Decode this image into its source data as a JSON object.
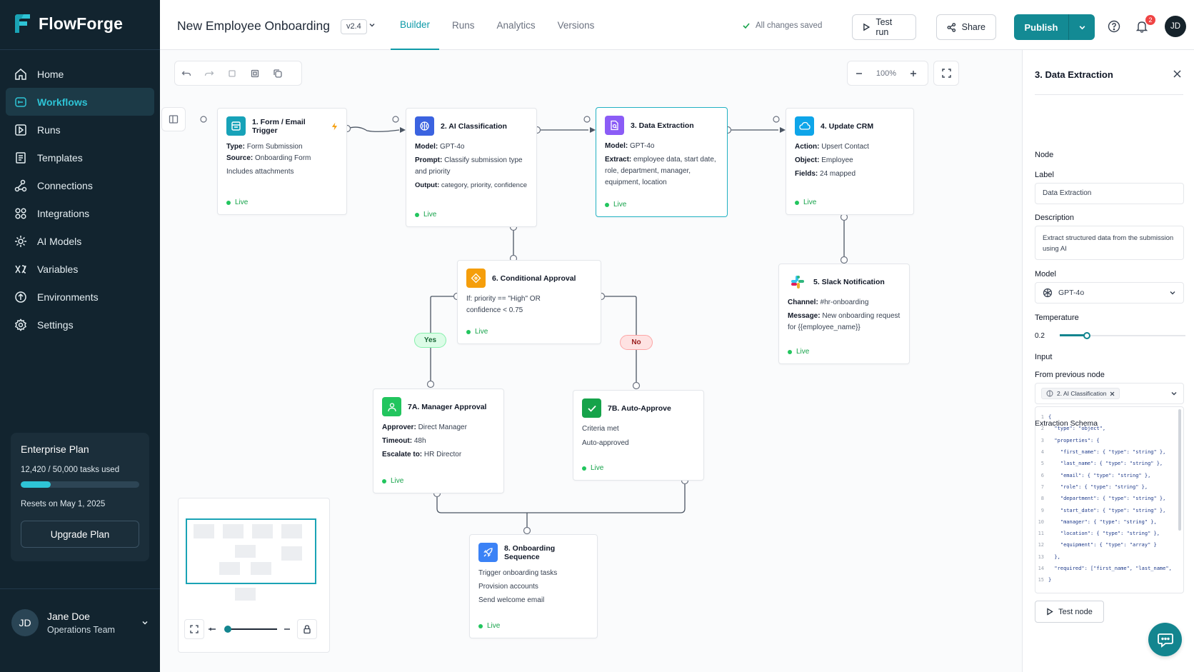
{
  "app": {
    "name": "FlowForge"
  },
  "sidebar": {
    "items": [
      {
        "label": "Home",
        "icon": "home-icon"
      },
      {
        "label": "Workflows",
        "icon": "workflow-icon",
        "active": true
      },
      {
        "label": "Runs",
        "icon": "runs-icon"
      },
      {
        "label": "Templates",
        "icon": "templates-icon"
      },
      {
        "label": "Connections",
        "icon": "connections-icon"
      },
      {
        "label": "Integrations",
        "icon": "integrations-icon"
      },
      {
        "label": "AI Models",
        "icon": "ai-models-icon"
      },
      {
        "label": "Variables",
        "icon": "variables-icon"
      },
      {
        "label": "Environments",
        "icon": "environments-icon"
      },
      {
        "label": "Settings",
        "icon": "settings-icon"
      }
    ],
    "plan": {
      "title": "Enterprise Plan",
      "usage": "12,420 / 50,000 tasks used",
      "usage_fraction": 0.25,
      "reset": "Resets on May 1, 2025",
      "button": "Upgrade Plan"
    },
    "user": {
      "initials": "JD",
      "name": "Jane Doe",
      "team": "Operations Team"
    }
  },
  "header": {
    "title": "New Employee Onboarding",
    "version": "v2.4",
    "tabs": [
      "Builder",
      "Runs",
      "Analytics",
      "Versions"
    ],
    "active_tab": "Builder",
    "saved": "All changes saved",
    "test_run": "Test run",
    "share": "Share",
    "publish": "Publish",
    "notifications": "2",
    "avatar": "JD"
  },
  "canvas": {
    "zoom": "100%"
  },
  "nodes": {
    "n1": {
      "title": "1. Form / Email Trigger",
      "rows": [
        {
          "k": "Type:",
          "v": " Form Submission"
        },
        {
          "k": "Source:",
          "v": " Onboarding Form"
        },
        {
          "k": "",
          "v": "Includes attachments"
        }
      ],
      "status": "Live"
    },
    "n2": {
      "title": "2. AI Classification",
      "rows": [
        {
          "k": "Model:",
          "v": " GPT-4o"
        },
        {
          "k": "Prompt:",
          "v": " Classify submission type and priority"
        },
        {
          "k": "Output:",
          "v": " category, priority, confidence"
        }
      ],
      "status": "Live"
    },
    "n3": {
      "title": "3. Data Extraction",
      "rows": [
        {
          "k": "Model:",
          "v": " GPT-4o"
        },
        {
          "k": "Extract:",
          "v": " employee data, start date, role, department, manager, equipment, location"
        }
      ],
      "status": "Live"
    },
    "n4": {
      "title": "4. Update CRM",
      "rows": [
        {
          "k": "Action:",
          "v": " Upsert Contact"
        },
        {
          "k": "Object:",
          "v": " Employee"
        },
        {
          "k": "Fields:",
          "v": " 24 mapped"
        }
      ],
      "status": "Live"
    },
    "n5": {
      "title": "5. Slack Notification",
      "rows": [
        {
          "k": "Channel:",
          "v": " #hr-onboarding"
        },
        {
          "k": "Message:",
          "v": " New onboarding request for {{employee_name}}"
        }
      ],
      "status": "Live"
    },
    "n6": {
      "title": "6. Conditional Approval",
      "rows": [
        {
          "k": "",
          "v": "If: priority == \"High\" OR confidence < 0.75"
        }
      ],
      "status": "Live"
    },
    "n7a": {
      "title": "7A. Manager Approval",
      "rows": [
        {
          "k": "Approver:",
          "v": " Direct Manager"
        },
        {
          "k": "Timeout:",
          "v": " 48h"
        },
        {
          "k": "Escalate to:",
          "v": " HR Director"
        }
      ],
      "status": "Live"
    },
    "n7b": {
      "title": "7B. Auto-Approve",
      "rows": [
        {
          "k": "",
          "v": "Criteria met"
        },
        {
          "k": "",
          "v": "Auto-approved"
        }
      ],
      "status": "Live"
    },
    "n8": {
      "title": "8. Onboarding Sequence",
      "rows": [
        {
          "k": "",
          "v": "Trigger onboarding tasks"
        },
        {
          "k": "",
          "v": "Provision accounts"
        },
        {
          "k": "",
          "v": "Send welcome email"
        }
      ],
      "status": "Live"
    }
  },
  "branches": {
    "yes": "Yes",
    "no": "No"
  },
  "panel": {
    "title": "3. Data Extraction",
    "section": "Node",
    "label_label": "Label",
    "label_value": "Data Extraction",
    "desc_label": "Description",
    "desc_value": "Extract structured data from the submission using AI",
    "model_label": "Model",
    "model_value": "GPT-4o",
    "temp_label": "Temperature",
    "temp_value": "0.2",
    "input_label": "Input",
    "input_sub": "From previous node",
    "input_chip": "2. AI Classification",
    "schema_label": "Extraction Schema",
    "schema_lines": [
      "{",
      "  \"type\": \"object\",",
      "  \"properties\": {",
      "    \"first_name\": { \"type\": \"string\" },",
      "    \"last_name\": { \"type\": \"string\" },",
      "    \"email\": { \"type\": \"string\" },",
      "    \"role\": { \"type\": \"string\" },",
      "    \"department\": { \"type\": \"string\" },",
      "    \"start_date\": { \"type\": \"string\" },",
      "    \"manager\": { \"type\": \"string\" },",
      "    \"location\": { \"type\": \"string\" },",
      "    \"equipment\": { \"type\": \"array\" }",
      "  },",
      "  \"required\": [\"first_name\", \"last_name\",",
      "}"
    ],
    "test_node": "Test node"
  },
  "colors": {
    "accent": "#0e9aa8",
    "sidebar": "#12242f",
    "live": "#22c55e"
  }
}
